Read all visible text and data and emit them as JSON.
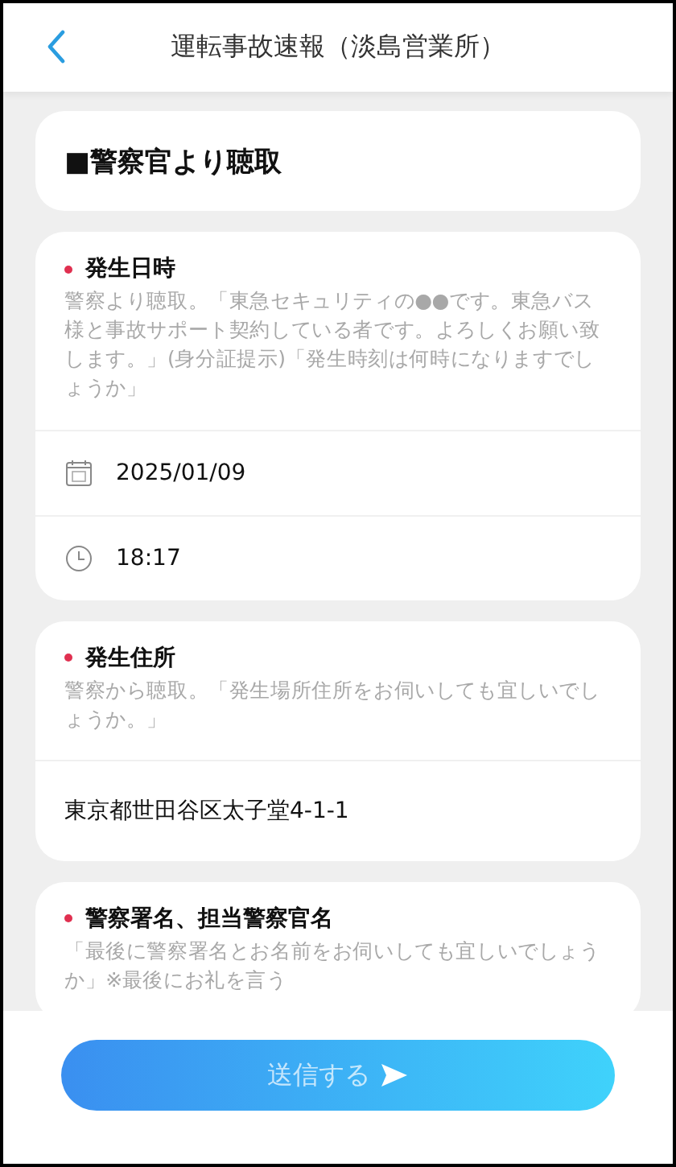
{
  "header": {
    "title": "運転事故速報（淡島営業所）"
  },
  "section_title": "■警察官より聴取",
  "sections": [
    {
      "label": "発生日時",
      "required": true,
      "hint": "警察より聴取。「東急セキュリティの●●です。東急バス様と事故サポート契約している者です。よろしくお願い致します。」(身分証提示)「発生時刻は何時になりますでしょうか」",
      "rows": [
        {
          "kind": "date",
          "value": "2025/01/09"
        },
        {
          "kind": "time",
          "value": "18:17"
        }
      ]
    },
    {
      "label": "発生住所",
      "required": true,
      "hint": "警察から聴取。「発生場所住所をお伺いしても宜しいでしょうか。」",
      "rows": [
        {
          "kind": "text",
          "value": "東京都世田谷区太子堂4-1-1"
        }
      ]
    },
    {
      "label": "警察署名、担当警察官名",
      "required": true,
      "hint": "「最後に警察署名とお名前をお伺いしても宜しいでしょうか」※最後にお礼を言う"
    }
  ],
  "submit": {
    "label": "送信する",
    "disabled": true
  }
}
